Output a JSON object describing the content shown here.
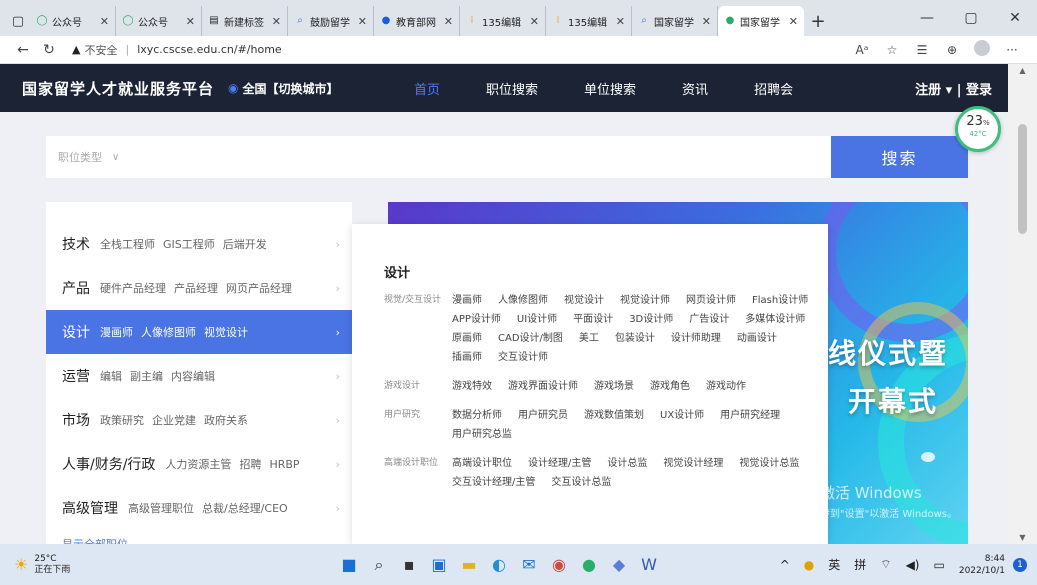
{
  "browser": {
    "tabs": [
      {
        "icon": "wechat-icon",
        "label": "公众号",
        "active": false
      },
      {
        "icon": "wechat-icon",
        "label": "公众号",
        "active": false
      },
      {
        "icon": "page-icon",
        "label": "新建标签",
        "active": false
      },
      {
        "icon": "search-icon",
        "label": "鼓励留学",
        "active": false
      },
      {
        "icon": "edu-icon",
        "label": "教育部网",
        "active": false
      },
      {
        "icon": "editor-icon",
        "label": "135编辑",
        "active": false
      },
      {
        "icon": "editor-icon",
        "label": "135编辑",
        "active": false
      },
      {
        "icon": "search-icon",
        "label": "国家留学",
        "active": false
      },
      {
        "icon": "site-icon",
        "label": "国家留学",
        "active": true
      }
    ],
    "new_tab": "+",
    "window_controls": {
      "minimize": "—",
      "restore": "▢",
      "close": "✕"
    },
    "address": {
      "security_label": "不安全",
      "url": "lxyc.cscse.edu.cn/#/home"
    }
  },
  "header": {
    "logo": "国家留学人才就业服务平台",
    "city": "全国【切换城市】",
    "nav": [
      {
        "label": "首页",
        "active": true
      },
      {
        "label": "职位搜索",
        "active": false
      },
      {
        "label": "单位搜索",
        "active": false
      },
      {
        "label": "资讯",
        "active": false
      },
      {
        "label": "招聘会",
        "active": false
      }
    ],
    "auth": "注册 ▾ | 登录"
  },
  "perf_widget": {
    "percent": "23",
    "percent_unit": "%",
    "temp": "42°C"
  },
  "search": {
    "category_placeholder": "职位类型",
    "button": "搜索"
  },
  "categories": [
    {
      "title": "技术",
      "subs": [
        "全栈工程师",
        "GIS工程师",
        "后端开发"
      ],
      "active": false
    },
    {
      "title": "产品",
      "subs": [
        "硬件产品经理",
        "产品经理",
        "网页产品经理"
      ],
      "active": false
    },
    {
      "title": "设计",
      "subs": [
        "漫画师",
        "人像修图师",
        "视觉设计"
      ],
      "active": true
    },
    {
      "title": "运营",
      "subs": [
        "编辑",
        "副主编",
        "内容编辑"
      ],
      "active": false
    },
    {
      "title": "市场",
      "subs": [
        "政策研究",
        "企业党建",
        "政府关系"
      ],
      "active": false
    },
    {
      "title": "人事/财务/行政",
      "subs": [
        "人力资源主管",
        "招聘",
        "HRBP"
      ],
      "active": false
    },
    {
      "title": "高级管理",
      "subs": [
        "高级管理职位",
        "总裁/总经理/CEO"
      ],
      "active": false
    }
  ],
  "show_all": "显示全部职位",
  "submenu": {
    "title": "设计",
    "groups": [
      {
        "label": "视觉/交互设计",
        "items": [
          "漫画师",
          "人像修图师",
          "视觉设计",
          "视觉设计师",
          "网页设计师",
          "Flash设计师",
          "APP设计师",
          "UI设计师",
          "平面设计",
          "3D设计师",
          "广告设计",
          "多媒体设计师",
          "原画师",
          "CAD设计/制图",
          "美工",
          "包装设计",
          "设计师助理",
          "动画设计",
          "插画师",
          "交互设计师"
        ]
      },
      {
        "label": "游戏设计",
        "items": [
          "游戏特效",
          "游戏界面设计师",
          "游戏场景",
          "游戏角色",
          "游戏动作"
        ]
      },
      {
        "label": "用户研究",
        "items": [
          "数据分析师",
          "用户研究员",
          "游戏数值策划",
          "UX设计师",
          "用户研究经理",
          "用户研究总监"
        ]
      },
      {
        "label": "高端设计职位",
        "items": [
          "高端设计职位",
          "设计经理/主管",
          "设计总监",
          "视觉设计经理",
          "视觉设计总监",
          "交互设计经理/主管",
          "交互设计总监"
        ]
      }
    ]
  },
  "banner": {
    "line1": "线仪式暨",
    "line2": "开幕式"
  },
  "watermark": {
    "line1": "激活 Windows",
    "line2": "转到\"设置\"以激活 Windows。"
  },
  "taskbar": {
    "weather_temp": "25°C",
    "weather_desc": "正在下雨",
    "ime_lang": "英",
    "ime_mode": "拼",
    "time": "8:44",
    "date": "2022/10/1",
    "notifications": "1"
  }
}
